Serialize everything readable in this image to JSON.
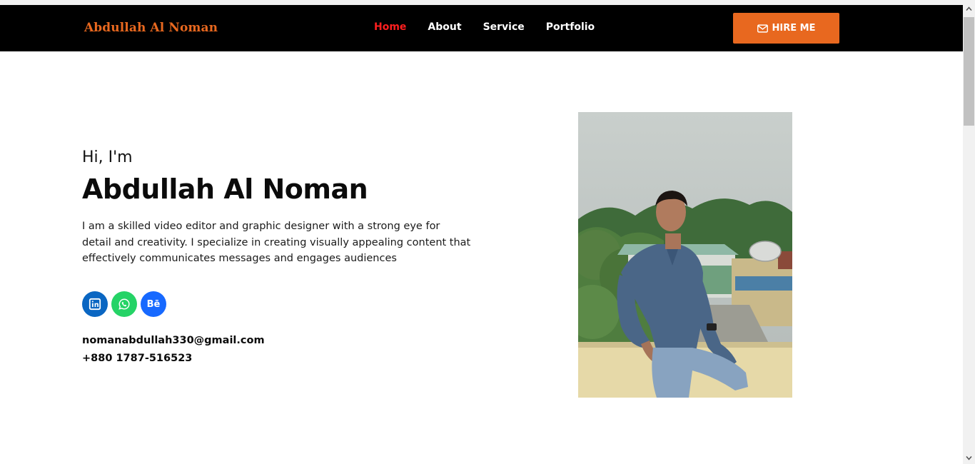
{
  "brand": "Abdullah Al Noman",
  "nav": {
    "items": [
      {
        "label": "Home",
        "active": true
      },
      {
        "label": "About",
        "active": false
      },
      {
        "label": "Service",
        "active": false
      },
      {
        "label": "Portfolio",
        "active": false
      }
    ],
    "hire_label": "HIRE ME",
    "hire_icon": "envelope-icon"
  },
  "hero": {
    "greeting": "Hi, I'm",
    "name": "Abdullah Al Noman",
    "bio": "I am a skilled video editor and graphic designer with a strong eye for detail and creativity. I specialize in creating visually appealing content that effectively communicates messages and engages audiences",
    "socials": [
      {
        "icon": "linkedin-icon"
      },
      {
        "icon": "whatsapp-icon"
      },
      {
        "icon": "behance-icon",
        "text": "Bē"
      }
    ],
    "email": "nomanabdullah330@gmail.com",
    "phone": "+880 1787-516523"
  },
  "colors": {
    "accent": "#e8681f",
    "active_nav": "#ff1f1f",
    "navbar_bg": "#000000",
    "linkedin": "#0a66c2",
    "whatsapp": "#25d366",
    "behance": "#1769ff"
  }
}
